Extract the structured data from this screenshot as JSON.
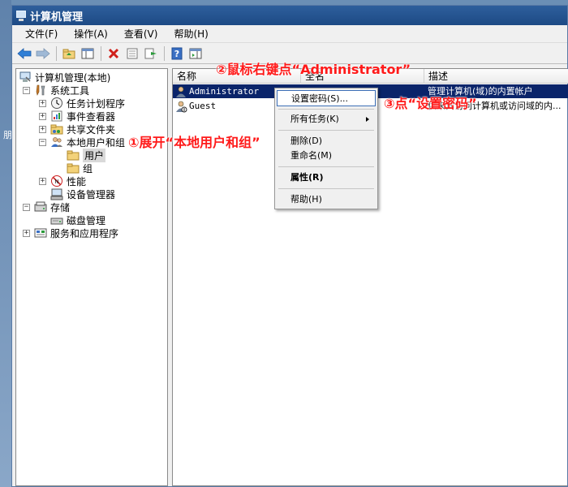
{
  "window": {
    "title": "计算机管理"
  },
  "menubar": [
    "文件(F)",
    "操作(A)",
    "查看(V)",
    "帮助(H)"
  ],
  "toolbar": {
    "icons": [
      "back-arrow-icon",
      "forward-arrow-icon",
      "up-folder-icon",
      "show-hide-tree-icon",
      "delete-icon",
      "properties-icon",
      "export-list-icon",
      "help-icon",
      "action-pane-icon"
    ]
  },
  "desktop": {
    "glyph": "朋"
  },
  "tree": {
    "root": "计算机管理(本地)",
    "system_tools": "系统工具",
    "task_scheduler": "任务计划程序",
    "event_viewer": "事件查看器",
    "shared_folders": "共享文件夹",
    "local_users_groups": "本地用户和组",
    "users": "用户",
    "groups": "组",
    "performance": "性能",
    "device_manager": "设备管理器",
    "storage": "存储",
    "disk_management": "磁盘管理",
    "services_apps": "服务和应用程序"
  },
  "list": {
    "columns": [
      "名称",
      "全名",
      "描述"
    ],
    "rows": [
      {
        "name": "Administrator",
        "fullname": "",
        "description": "管理计算机(域)的内置帐户"
      },
      {
        "name": "Guest",
        "fullname": "",
        "description": "供来宾访问计算机或访问域的内..."
      }
    ]
  },
  "context_menu": {
    "set_password": "设置密码(S)...",
    "all_tasks": "所有任务(K)",
    "delete": "删除(D)",
    "rename": "重命名(M)",
    "properties": "属性(R)",
    "help": "帮助(H)"
  },
  "annotations": {
    "step1": "①展开“本地用户和组”",
    "step2": "②鼠标右键点“Administrator”",
    "step3": "③点“设置密码”"
  },
  "colors": {
    "annotation": "#ff1a1a",
    "selection": "#0a246a",
    "titlebar": "#2e5f9c"
  }
}
